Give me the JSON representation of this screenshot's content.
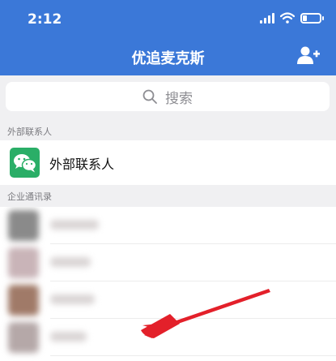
{
  "status_bar": {
    "time": "2:12",
    "battery_level": 0.25
  },
  "header": {
    "title": "优追麦克斯",
    "add_contact_icon": "add-user-icon"
  },
  "search": {
    "placeholder": "搜索",
    "icon": "search-icon"
  },
  "sections": {
    "external": {
      "label": "外部联系人",
      "item_label": "外部联系人",
      "item_icon": "wechat-icon"
    },
    "directory": {
      "label": "企业通讯录"
    }
  },
  "colors": {
    "header_bg": "#3b78d8",
    "wechat_green": "#2aae67",
    "annotation_arrow": "#e3202a"
  }
}
